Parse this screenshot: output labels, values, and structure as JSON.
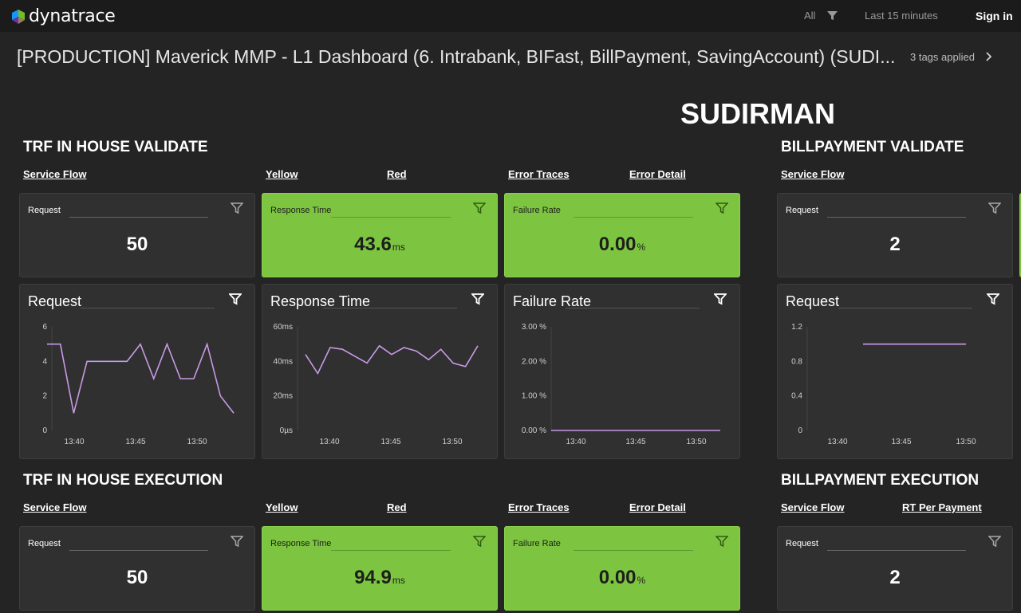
{
  "topbar": {
    "logo_text": "dynatrace",
    "filter_label": "All",
    "timeframe": "Last 15 minutes",
    "signin": "Sign in"
  },
  "dashboard": {
    "title": "[PRODUCTION] Maverick MMP - L1 Dashboard (6. Intrabank, BIFast, BillPayment, SavingAccount) (SUDI...",
    "tags": "3 tags applied",
    "heading": "SUDIRMAN"
  },
  "sections": {
    "trf_validate": {
      "title": "TRF IN HOUSE VALIDATE",
      "links": [
        "Service Flow",
        "Yellow",
        "Red",
        "Error Traces",
        "Error Detail"
      ]
    },
    "bill_validate": {
      "title": "BILLPAYMENT VALIDATE",
      "links": [
        "Service Flow"
      ]
    },
    "trf_exec": {
      "title": "TRF IN HOUSE EXECUTION",
      "links": [
        "Service Flow",
        "Yellow",
        "Red",
        "Error Traces",
        "Error Detail"
      ]
    },
    "bill_exec": {
      "title": "BILLPAYMENT EXECUTION",
      "links": [
        "Service Flow",
        "RT Per Payment"
      ]
    }
  },
  "tiles": {
    "trf_validate_request": {
      "title": "Request",
      "value": "50",
      "unit": ""
    },
    "trf_validate_rt": {
      "title": "Response Time",
      "value": "43.6",
      "unit": "ms"
    },
    "trf_validate_fr": {
      "title": "Failure Rate",
      "value": "0.00",
      "unit": "%"
    },
    "bill_validate_request": {
      "title": "Request",
      "value": "2",
      "unit": ""
    },
    "trf_exec_request": {
      "title": "Request",
      "value": "50",
      "unit": ""
    },
    "trf_exec_rt": {
      "title": "Response Time",
      "value": "94.9",
      "unit": "ms"
    },
    "trf_exec_fr": {
      "title": "Failure Rate",
      "value": "0.00",
      "unit": "%"
    },
    "bill_exec_request": {
      "title": "Request",
      "value": "2",
      "unit": ""
    }
  },
  "colors": {
    "accent_green": "#7dc540",
    "series_line": "#c89ae6",
    "tile_bg": "#303030"
  },
  "chart_data": [
    {
      "id": "trf_request",
      "type": "line",
      "title": "Request",
      "x_ticks": [
        "13:40",
        "13:45",
        "13:50"
      ],
      "y_ticks": [
        "0",
        "2",
        "4",
        "6"
      ],
      "ylim": [
        0,
        6
      ],
      "x": [
        "13:37",
        "13:38",
        "13:39",
        "13:40",
        "13:41",
        "13:42",
        "13:43",
        "13:44",
        "13:45",
        "13:46",
        "13:47",
        "13:48",
        "13:49",
        "13:50",
        "13:51",
        "13:52"
      ],
      "values": [
        5,
        5,
        1,
        4,
        4,
        4,
        4,
        5,
        3,
        5,
        3,
        3,
        5,
        2,
        1
      ]
    },
    {
      "id": "trf_rt",
      "type": "line",
      "title": "Response Time",
      "x_ticks": [
        "13:40",
        "13:45",
        "13:50"
      ],
      "y_ticks": [
        "0µs",
        "20ms",
        "40ms",
        "60ms"
      ],
      "ylim": [
        0,
        60
      ],
      "unit": "ms",
      "values": [
        44,
        33,
        48,
        47,
        43,
        39,
        49,
        44,
        48,
        46,
        41,
        47,
        39,
        37,
        49
      ]
    },
    {
      "id": "trf_fr",
      "type": "line",
      "title": "Failure Rate",
      "x_ticks": [
        "13:40",
        "13:45",
        "13:50"
      ],
      "y_ticks": [
        "0.00 %",
        "1.00 %",
        "2.00 %",
        "3.00 %"
      ],
      "ylim": [
        0,
        3
      ],
      "unit": "%",
      "values": [
        0,
        0,
        0,
        0,
        0,
        0,
        0,
        0,
        0,
        0,
        0,
        0,
        0,
        0,
        0
      ]
    },
    {
      "id": "bill_request",
      "type": "line",
      "title": "Request",
      "x_ticks": [
        "13:40",
        "13:45",
        "13:50"
      ],
      "y_ticks": [
        "0",
        "0.4",
        "0.8",
        "1.2"
      ],
      "ylim": [
        0,
        1.2
      ],
      "values": [
        1,
        1,
        1,
        1,
        1,
        1,
        1,
        1,
        1,
        1,
        1
      ]
    }
  ]
}
